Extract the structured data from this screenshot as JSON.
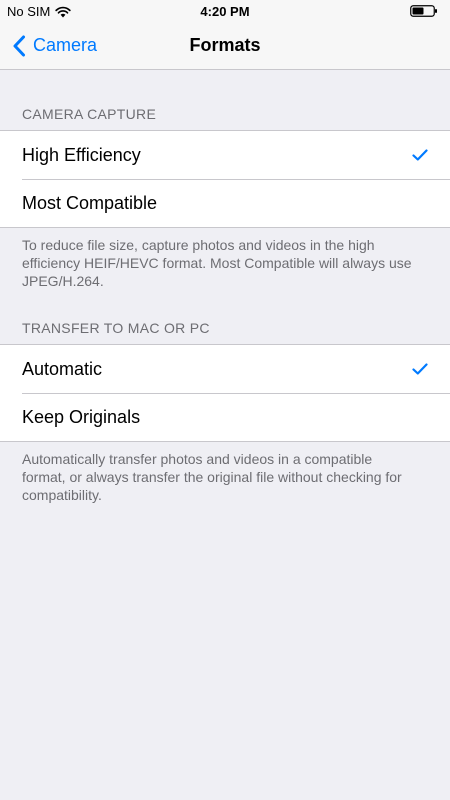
{
  "status_bar": {
    "carrier": "No SIM",
    "time": "4:20 PM",
    "wifi_icon": "wifi-icon",
    "battery_icon": "battery-icon"
  },
  "nav": {
    "back_label": "Camera",
    "back_icon": "chevron-left-icon",
    "title": "Formats"
  },
  "camera_capture": {
    "header": "CAMERA CAPTURE",
    "options": [
      {
        "label": "High Efficiency",
        "selected": true
      },
      {
        "label": "Most Compatible",
        "selected": false
      }
    ],
    "footer": "To reduce file size, capture photos and videos in the high efficiency HEIF/HEVC format. Most Compatible will always use JPEG/H.264."
  },
  "transfer": {
    "header": "TRANSFER TO MAC OR PC",
    "options": [
      {
        "label": "Automatic",
        "selected": true
      },
      {
        "label": "Keep Originals",
        "selected": false
      }
    ],
    "footer": "Automatically transfer photos and videos in a compatible format, or always transfer the original file without checking for compatibility."
  },
  "colors": {
    "accent": "#007aff",
    "background": "#efeff4",
    "secondary_text": "#6d6d72",
    "separator": "#c8c7cc"
  }
}
